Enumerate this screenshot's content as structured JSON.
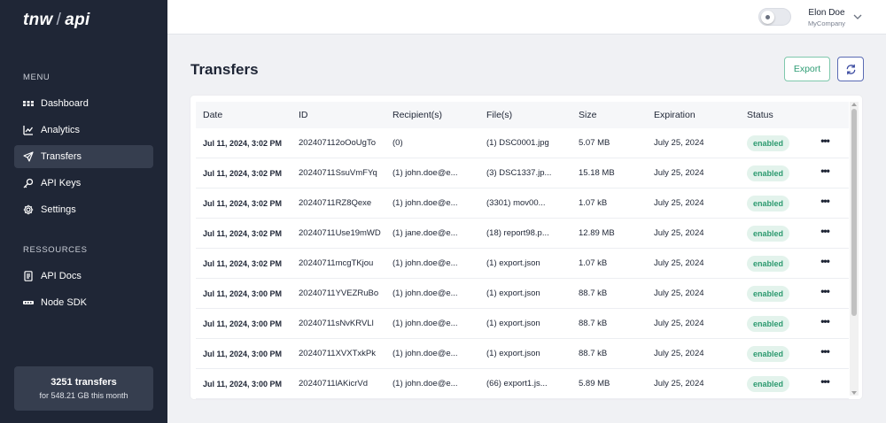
{
  "sidebar": {
    "logo_left": "tnw",
    "logo_sep": "/",
    "logo_right": "api",
    "menu_title": "MENU",
    "menu_items": [
      {
        "label": "Dashboard",
        "icon": "grid-icon"
      },
      {
        "label": "Analytics",
        "icon": "chart-icon"
      },
      {
        "label": "Transfers",
        "icon": "send-icon",
        "active": true
      },
      {
        "label": "API Keys",
        "icon": "key-icon"
      },
      {
        "label": "Settings",
        "icon": "gear-icon"
      }
    ],
    "resources_title": "RESSOURCES",
    "resource_items": [
      {
        "label": "API Docs",
        "icon": "document-icon"
      },
      {
        "label": "Node SDK",
        "icon": "sdk-icon"
      }
    ],
    "usage": {
      "count": "3251 transfers",
      "detail": "for 548.21 GB this month"
    }
  },
  "header": {
    "user_name": "Elon Doe",
    "company": "MyCompany"
  },
  "main": {
    "title": "Transfers",
    "export_label": "Export",
    "table": {
      "columns": [
        "Date",
        "ID",
        "Recipient(s)",
        "File(s)",
        "Size",
        "Expiration",
        "Status"
      ],
      "rows": [
        {
          "date": "Jul 11, 2024, 3:02 PM",
          "id": "202407112oOoUgTo",
          "recipients": "(0)",
          "files": "(1) DSC0001.jpg",
          "size": "5.07 MB",
          "expiration": "July 25, 2024",
          "status": "enabled"
        },
        {
          "date": "Jul 11, 2024, 3:02 PM",
          "id": "20240711SsuVmFYq",
          "recipients": "(1) john.doe@e...",
          "files": "(3) DSC1337.jp...",
          "size": "15.18 MB",
          "expiration": "July 25, 2024",
          "status": "enabled"
        },
        {
          "date": "Jul 11, 2024, 3:02 PM",
          "id": "20240711RZ8Qexe",
          "recipients": "(1) john.doe@e...",
          "files": "(3301) mov00...",
          "size": "1.07 kB",
          "expiration": "July 25, 2024",
          "status": "enabled"
        },
        {
          "date": "Jul 11, 2024, 3:02 PM",
          "id": "20240711Use19mWD",
          "recipients": "(1) jane.doe@e...",
          "files": "(18) report98.p...",
          "size": "12.89 MB",
          "expiration": "July 25, 2024",
          "status": "enabled"
        },
        {
          "date": "Jul 11, 2024, 3:02 PM",
          "id": "20240711mcgTKjou",
          "recipients": "(1) john.doe@e...",
          "files": "(1) export.json",
          "size": "1.07 kB",
          "expiration": "July 25, 2024",
          "status": "enabled"
        },
        {
          "date": "Jul 11, 2024, 3:00 PM",
          "id": "20240711YVEZRuBo",
          "recipients": "(1) john.doe@e...",
          "files": "(1) export.json",
          "size": "88.7 kB",
          "expiration": "July 25, 2024",
          "status": "enabled"
        },
        {
          "date": "Jul 11, 2024, 3:00 PM",
          "id": "20240711sNvKRVLl",
          "recipients": "(1) john.doe@e...",
          "files": "(1) export.json",
          "size": "88.7 kB",
          "expiration": "July 25, 2024",
          "status": "enabled"
        },
        {
          "date": "Jul 11, 2024, 3:00 PM",
          "id": "20240711XVXTxkPk",
          "recipients": "(1) john.doe@e...",
          "files": "(1) export.json",
          "size": "88.7 kB",
          "expiration": "July 25, 2024",
          "status": "enabled"
        },
        {
          "date": "Jul 11, 2024, 3:00 PM",
          "id": "20240711lAKicrVd",
          "recipients": "(1) john.doe@e...",
          "files": "(66) export1.js...",
          "size": "5.89 MB",
          "expiration": "July 25, 2024",
          "status": "enabled"
        }
      ],
      "more_label": "•••"
    }
  },
  "colors": {
    "sidebar_bg": "#1f2636",
    "active_item_bg": "#363e4f",
    "accent_green": "#2f9d75",
    "badge_bg": "#e3f3ec",
    "refresh_border": "#5a6bb4"
  }
}
